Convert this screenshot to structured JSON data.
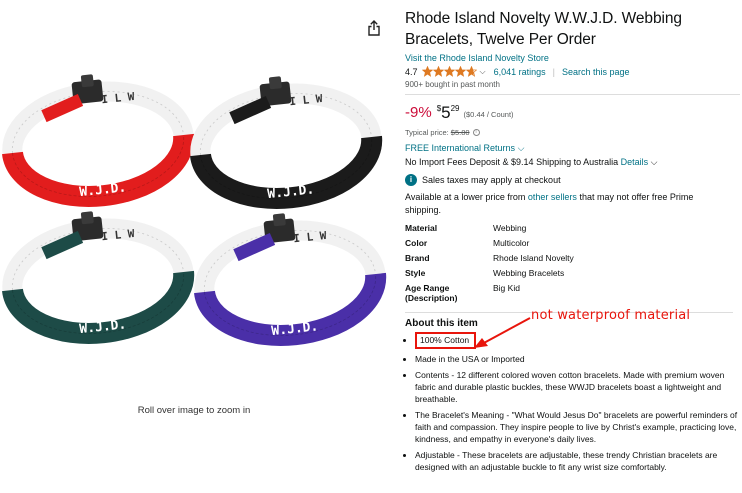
{
  "gallery": {
    "zoom_hint": "Roll over image to zoom in",
    "print_top": "I L W",
    "print_bottom": "W.J.D.",
    "colors": {
      "red": "#e21d1d",
      "black": "#1b1b1b",
      "teal": "#1d4b47",
      "purple": "#4a2fa8",
      "inner": "#f1f1f1"
    }
  },
  "product": {
    "title": "Rhode Island Novelty W.W.J.D. Webbing Bracelets, Twelve Per Order",
    "store_link": "Visit the Rhode Island Novelty Store",
    "rating_value": "4.7",
    "rating_stars": 4.7,
    "ratings_count": "6,041 ratings",
    "search_link": "Search this page",
    "bought": "900+ bought in past month",
    "price": {
      "discount": "-9%",
      "currency": "$",
      "whole": "5",
      "fraction": "29",
      "per_unit": "($0.44 / Count)",
      "typical_label": "Typical price:",
      "typical_value": "$5.80"
    },
    "returns": "FREE International Returns",
    "deposit_text": "No Import Fees Deposit & $9.14 Shipping to Australia",
    "deposit_link": "Details",
    "tax_note": "Sales taxes may apply at checkout",
    "lower_price_pre": "Available at a lower price from",
    "lower_price_link": "other sellers",
    "lower_price_post": "that may not offer free Prime shipping.",
    "specs": [
      {
        "key": "Material",
        "value": "Webbing"
      },
      {
        "key": "Color",
        "value": "Multicolor"
      },
      {
        "key": "Brand",
        "value": "Rhode Island Novelty"
      },
      {
        "key": "Style",
        "value": "Webbing Bracelets"
      },
      {
        "key": "Age Range (Description)",
        "value": "Big Kid"
      }
    ],
    "about_heading": "About this item",
    "bullets": [
      "100% Cotton",
      "Made in the USA or Imported",
      "Contents - 12 different colored woven cotton bracelets. Made with premium woven fabric and durable plastic buckles, these WWJD bracelets boast a lightweight and breathable.",
      "The Bracelet's Meaning - \"What Would Jesus Do\" bracelets are powerful reminders of faith and compassion. They inspire people to live by Christ's example, practicing love, kindness, and empathy in everyone's daily lives.",
      "Adjustable - These bracelets are adjustable, these trendy Christian bracelets are designed with an adjustable buckle to fit any wrist size comfortably."
    ]
  },
  "annotation": {
    "text": "not waterproof material",
    "color": "#e8150c"
  },
  "colors": {
    "link": "#007185",
    "star": "#de7921",
    "price_red": "#cc0c39"
  }
}
